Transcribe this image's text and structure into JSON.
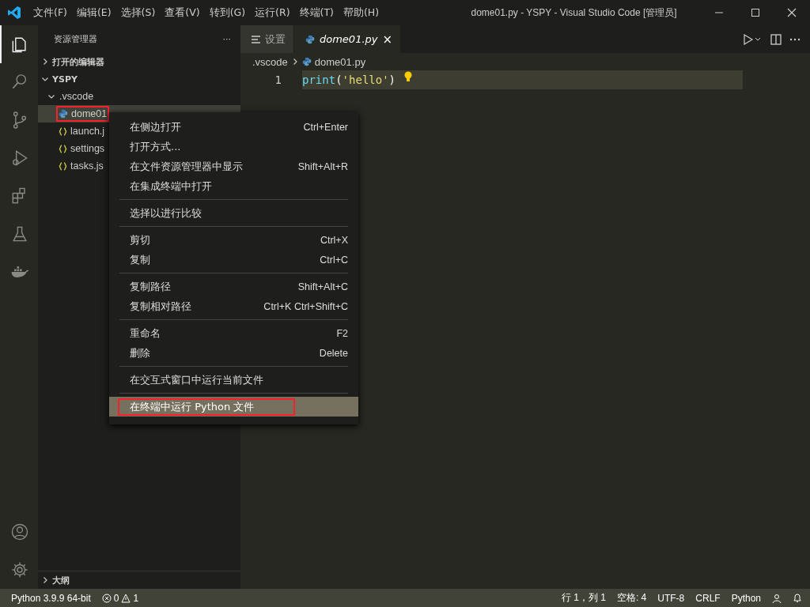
{
  "title_bar": {
    "menu": [
      "文件(F)",
      "编辑(E)",
      "选择(S)",
      "查看(V)",
      "转到(G)",
      "运行(R)",
      "终端(T)",
      "帮助(H)"
    ],
    "title": "dome01.py - YSPY - Visual Studio Code [管理员]"
  },
  "activity_bar": {
    "items": [
      {
        "kind": "explorer",
        "selected": true
      },
      {
        "kind": "search",
        "selected": false
      },
      {
        "kind": "source-control",
        "selected": false
      },
      {
        "kind": "debug",
        "selected": false
      },
      {
        "kind": "extensions",
        "selected": false
      },
      {
        "kind": "flask",
        "selected": false
      },
      {
        "kind": "whale",
        "selected": false
      }
    ],
    "bottom": [
      {
        "kind": "account"
      },
      {
        "kind": "settings"
      }
    ]
  },
  "sidebar": {
    "title": "资源管理器",
    "more": "···",
    "sections": [
      {
        "label": "打开的编辑器",
        "expanded": false
      },
      {
        "label": "YSPY",
        "expanded": true,
        "children": [
          {
            "label": ".vscode",
            "kind": "folder",
            "expanded": true,
            "children": [
              {
                "label": "dome01",
                "kind": "python",
                "selected": true,
                "annotated": true
              },
              {
                "label": "launch.j",
                "kind": "json",
                "selected": false
              },
              {
                "label": "settings",
                "kind": "json",
                "selected": false
              },
              {
                "label": "tasks.js",
                "kind": "json",
                "selected": false
              }
            ]
          }
        ]
      }
    ],
    "outline": {
      "label": "大纲",
      "expanded": false
    }
  },
  "editor": {
    "tabs": [
      {
        "label": "设置",
        "kind": "settings",
        "selected": false,
        "italic": false
      },
      {
        "label": "dome01.py",
        "kind": "python",
        "selected": true,
        "italic": true,
        "close": "×"
      }
    ],
    "breadcrumb": [
      ".vscode",
      "dome01.py"
    ],
    "lines": [
      {
        "number": "1",
        "tokens": [
          {
            "text": "print",
            "kind": "function"
          },
          {
            "text": "(",
            "kind": "punct"
          },
          {
            "text": "'hello'",
            "kind": "string"
          },
          {
            "text": ")",
            "kind": "punct"
          }
        ]
      }
    ]
  },
  "context_menu": {
    "groups": [
      [
        {
          "label": "在侧边打开",
          "shortcut": "Ctrl+Enter",
          "selected": false,
          "annotated": false
        },
        {
          "label": "打开方式...",
          "selected": false,
          "annotated": false
        },
        {
          "label": "在文件资源管理器中显示",
          "shortcut": "Shift+Alt+R",
          "selected": false,
          "annotated": false
        },
        {
          "label": "在集成终端中打开",
          "selected": false,
          "annotated": false
        }
      ],
      [
        {
          "label": "选择以进行比较",
          "selected": false,
          "annotated": false
        }
      ],
      [
        {
          "label": "剪切",
          "shortcut": "Ctrl+X",
          "selected": false,
          "annotated": false
        },
        {
          "label": "复制",
          "shortcut": "Ctrl+C",
          "selected": false,
          "annotated": false
        }
      ],
      [
        {
          "label": "复制路径",
          "shortcut": "Shift+Alt+C",
          "selected": false,
          "annotated": false
        },
        {
          "label": "复制相对路径",
          "shortcut": "Ctrl+K Ctrl+Shift+C",
          "selected": false,
          "annotated": false
        }
      ],
      [
        {
          "label": "重命名",
          "shortcut": "F2",
          "selected": false,
          "annotated": false
        },
        {
          "label": "删除",
          "shortcut": "Delete",
          "selected": false,
          "annotated": false
        }
      ],
      [
        {
          "label": "在交互式窗口中运行当前文件",
          "selected": false,
          "annotated": false
        }
      ],
      [
        {
          "label": "在终端中运行 Python 文件",
          "selected": true,
          "annotated": true
        }
      ]
    ]
  },
  "status_bar": {
    "interpreter": "Python 3.9.9 64-bit",
    "errors": "0",
    "warnings": "1",
    "right": [
      "行 1，列 1",
      "空格: 4",
      "UTF-8",
      "CRLF",
      "Python"
    ]
  }
}
